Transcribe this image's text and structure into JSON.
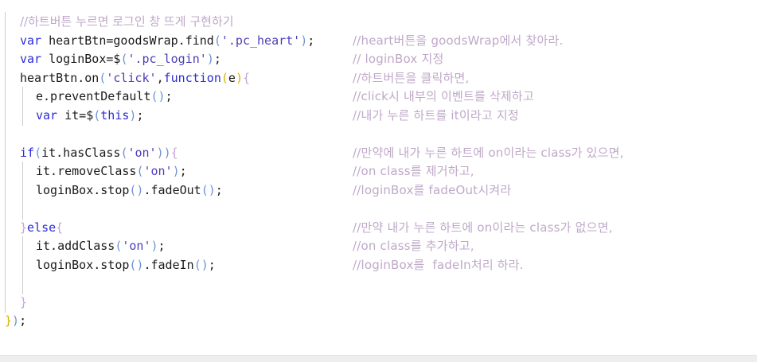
{
  "code_lines": [
    {
      "indent": 1,
      "comment_top": "//하트버튼 누르면 로그인 창 뜨게 구현하기"
    },
    {
      "indent": 1,
      "tokens": [
        [
          "kw",
          "var"
        ],
        [
          "id",
          " heartBtn=goodsWrap.find"
        ],
        [
          "paren",
          "("
        ],
        [
          "str",
          "'.pc_heart'"
        ],
        [
          "paren",
          ")"
        ],
        [
          "pun",
          ";"
        ]
      ],
      "comment": "//heart버튼을 goodsWrap에서 찾아라."
    },
    {
      "indent": 1,
      "tokens": [
        [
          "kw",
          "var"
        ],
        [
          "id",
          " loginBox=$"
        ],
        [
          "paren",
          "("
        ],
        [
          "str",
          "'.pc_login'"
        ],
        [
          "paren",
          ")"
        ],
        [
          "pun",
          ";"
        ]
      ],
      "comment": "// loginBox 지정"
    },
    {
      "indent": 1,
      "tokens": [
        [
          "id",
          "heartBtn.on"
        ],
        [
          "paren",
          "("
        ],
        [
          "str",
          "'click'"
        ],
        [
          "pun",
          ","
        ],
        [
          "kw",
          "function"
        ],
        [
          "y-paren",
          "("
        ],
        [
          "id",
          "e"
        ],
        [
          "y-paren",
          ")"
        ],
        [
          "brace",
          "{"
        ]
      ],
      "comment": "//하트버튼을 클릭하면,"
    },
    {
      "indent": 2,
      "tokens": [
        [
          "id",
          "e.preventDefault"
        ],
        [
          "paren",
          "()"
        ],
        [
          "pun",
          ";"
        ]
      ],
      "comment": "//click시 내부의 이벤트를 삭제하고"
    },
    {
      "indent": 2,
      "tokens": [
        [
          "kw",
          "var"
        ],
        [
          "id",
          " it=$"
        ],
        [
          "paren",
          "("
        ],
        [
          "kw",
          "this"
        ],
        [
          "paren",
          ")"
        ],
        [
          "pun",
          ";"
        ]
      ],
      "comment": "//내가 누른 하트를 it이라고 지정"
    },
    {
      "indent": 1,
      "tokens": []
    },
    {
      "indent": 1,
      "tokens": [
        [
          "kw",
          "if"
        ],
        [
          "paren",
          "("
        ],
        [
          "id",
          "it.hasClass"
        ],
        [
          "paren",
          "("
        ],
        [
          "str",
          "'on'"
        ],
        [
          "paren",
          "))"
        ],
        [
          "brace",
          "{"
        ]
      ],
      "comment": "//만약에 내가 누른 하트에 on이라는 class가 있으면,"
    },
    {
      "indent": 2,
      "tokens": [
        [
          "id",
          "it.removeClass"
        ],
        [
          "paren",
          "("
        ],
        [
          "str",
          "'on'"
        ],
        [
          "paren",
          ")"
        ],
        [
          "pun",
          ";"
        ]
      ],
      "comment": "//on class를 제거하고,"
    },
    {
      "indent": 2,
      "tokens": [
        [
          "id",
          "loginBox.stop"
        ],
        [
          "paren",
          "()"
        ],
        [
          "pun",
          "."
        ],
        [
          "id",
          "fadeOut"
        ],
        [
          "paren",
          "()"
        ],
        [
          "pun",
          ";"
        ]
      ],
      "comment": "//loginBox를 fadeOut시켜라"
    },
    {
      "indent": 1,
      "tokens": []
    },
    {
      "indent": 1,
      "tokens": [
        [
          "brace",
          "}"
        ],
        [
          "kw",
          "else"
        ],
        [
          "brace",
          "{"
        ]
      ],
      "comment": "//만약 내가 누른 하트에 on이라는 class가 없으면,"
    },
    {
      "indent": 2,
      "tokens": [
        [
          "id",
          "it.addClass"
        ],
        [
          "paren",
          "("
        ],
        [
          "str",
          "'on'"
        ],
        [
          "paren",
          ")"
        ],
        [
          "pun",
          ";"
        ]
      ],
      "comment": "//on class를 추가하고,"
    },
    {
      "indent": 2,
      "tokens": [
        [
          "id",
          "loginBox.stop"
        ],
        [
          "paren",
          "()"
        ],
        [
          "pun",
          "."
        ],
        [
          "id",
          "fadeIn"
        ],
        [
          "paren",
          "()"
        ],
        [
          "pun",
          ";"
        ]
      ],
      "comment": "//loginBox를  fadeIn처리 하라."
    },
    {
      "indent": 1,
      "tokens": []
    },
    {
      "indent": 1,
      "tokens": [
        [
          "brace",
          "}"
        ]
      ]
    },
    {
      "indent": 0,
      "tokens": [
        [
          "y-paren",
          "}"
        ],
        [
          "paren",
          ")"
        ],
        [
          "pun",
          ";"
        ]
      ]
    }
  ]
}
